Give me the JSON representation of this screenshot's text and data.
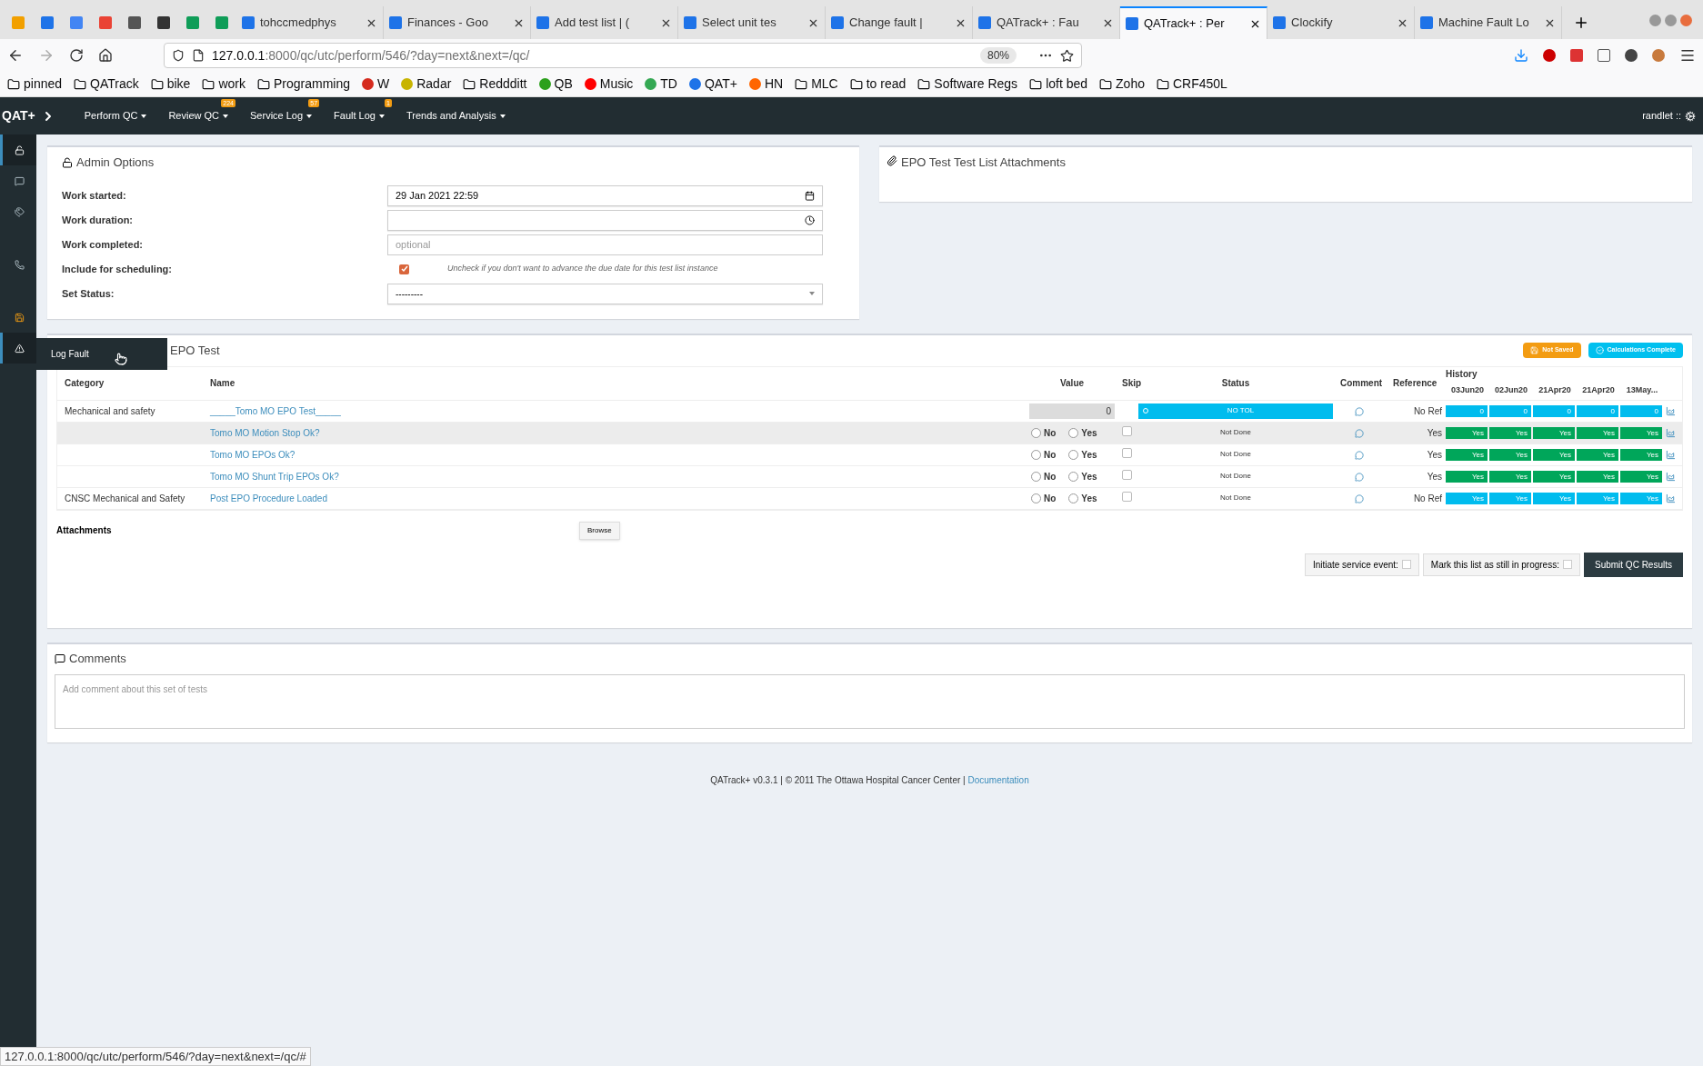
{
  "browser": {
    "tabs": [
      {
        "title": "tohccmedphys",
        "selected": false
      },
      {
        "title": "Finances - Goo",
        "selected": false
      },
      {
        "title": "Add test list | (",
        "selected": false
      },
      {
        "title": "Select unit tes",
        "selected": false
      },
      {
        "title": "Change fault |",
        "selected": false
      },
      {
        "title": "QATrack+ : Fau",
        "selected": false
      },
      {
        "title": "QATrack+ : Per",
        "selected": true
      },
      {
        "title": "Clockify",
        "selected": false
      },
      {
        "title": "Machine Fault Lo",
        "selected": false
      }
    ],
    "url_host": "127.0.0.1",
    "url_rest": ":8000/qc/utc/perform/546/?day=next&next=/qc/",
    "zoom": "80%",
    "bookmarks": [
      {
        "label": "pinned",
        "kind": "folder"
      },
      {
        "label": "QATrack",
        "kind": "folder"
      },
      {
        "label": "bike",
        "kind": "folder"
      },
      {
        "label": "work",
        "kind": "folder"
      },
      {
        "label": "Programming",
        "kind": "folder"
      },
      {
        "label": "W",
        "kind": "site",
        "color": "#d52b1e"
      },
      {
        "label": "Radar",
        "kind": "site",
        "color": "#c8b400"
      },
      {
        "label": "Reddditt",
        "kind": "folder"
      },
      {
        "label": "QB",
        "kind": "site",
        "color": "#2ca01c"
      },
      {
        "label": "Music",
        "kind": "site",
        "color": "#ff0000"
      },
      {
        "label": "TD",
        "kind": "site",
        "color": "#34a853"
      },
      {
        "label": "QAT+",
        "kind": "site",
        "color": "#1e73e8"
      },
      {
        "label": "HN",
        "kind": "site",
        "color": "#ff6600"
      },
      {
        "label": "MLC",
        "kind": "folder"
      },
      {
        "label": "to read",
        "kind": "folder"
      },
      {
        "label": "Software Regs",
        "kind": "folder"
      },
      {
        "label": "loft bed",
        "kind": "folder"
      },
      {
        "label": "Zoho",
        "kind": "folder"
      },
      {
        "label": "CRF450L",
        "kind": "folder"
      }
    ],
    "status_link": "127.0.0.1:8000/qc/utc/perform/546/?day=next&next=/qc/#"
  },
  "navbar": {
    "brand": "QAT+",
    "menus": [
      {
        "label": "Perform QC"
      },
      {
        "label": "Review QC",
        "badge": "224"
      },
      {
        "label": "Service Log",
        "badge": "57"
      },
      {
        "label": "Fault Log",
        "badge": "1"
      },
      {
        "label": "Trends and Analysis"
      }
    ],
    "user": "randlet ::"
  },
  "sidebar": {
    "items": [
      {
        "kind": "lock",
        "selected": true
      },
      {
        "kind": "comment",
        "selected": false
      },
      {
        "kind": "tags",
        "selected": false
      },
      {
        "kind": "phone",
        "selected": false
      },
      {
        "kind": "save",
        "selected": false
      },
      {
        "kind": "warning",
        "selected": true
      }
    ],
    "flyout": "Log Fault"
  },
  "admin": {
    "title": "Admin Options",
    "work_started_label": "Work started:",
    "work_started": "29 Jan 2021 22:59",
    "work_duration_label": "Work duration:",
    "work_completed_label": "Work completed:",
    "work_completed_placeholder": "optional",
    "scheduling_label": "Include for scheduling:",
    "scheduling_checked": true,
    "scheduling_hint": "Uncheck if you don't want to advance the due date for this test list instance",
    "status_label": "Set Status:",
    "status_value": "---------"
  },
  "attachments_panel": {
    "title": "EPO Test Test List Attachments"
  },
  "test_list": {
    "title": "EPO Test",
    "not_saved": "Not Saved",
    "calculations": "Calculations Complete",
    "columns": [
      "Category",
      "Name",
      "Value",
      "Skip",
      "Status",
      "Comment",
      "Reference",
      "History"
    ],
    "history_dates": [
      "03Jun20",
      "02Jun20",
      "21Apr20",
      "21Apr20",
      "13May..."
    ],
    "rows": [
      {
        "category": "Mechanical and safety",
        "name": "_____Tomo MO EPO Test_____",
        "kind": "numeric",
        "value": "0",
        "status": "NO TOL",
        "status_highlighted": true,
        "reference": "No Ref",
        "highlighted": false,
        "history": {
          "color": "#00bcee",
          "values": [
            "0",
            "0",
            "0",
            "0",
            "0"
          ]
        }
      },
      {
        "name": "Tomo MO Motion Stop Ok?",
        "kind": "boolean",
        "options": [
          {
            "label": "No",
            "selected": false
          },
          {
            "label": "Yes",
            "selected": false
          }
        ],
        "skipped": false,
        "status": "Not Done",
        "reference": "Yes",
        "highlighted": true,
        "history": {
          "color": "#00a65a",
          "values": [
            "Yes",
            "Yes",
            "Yes",
            "Yes",
            "Yes"
          ]
        }
      },
      {
        "name": "Tomo MO EPOs Ok?",
        "kind": "boolean",
        "options": [
          {
            "label": "No",
            "selected": false
          },
          {
            "label": "Yes",
            "selected": false
          }
        ],
        "skipped": false,
        "status": "Not Done",
        "reference": "Yes",
        "highlighted": false,
        "history": {
          "color": "#00a65a",
          "values": [
            "Yes",
            "Yes",
            "Yes",
            "Yes",
            "Yes"
          ]
        }
      },
      {
        "name": "Tomo MO Shunt Trip EPOs Ok?",
        "kind": "boolean",
        "options": [
          {
            "label": "No",
            "selected": false
          },
          {
            "label": "Yes",
            "selected": false
          }
        ],
        "skipped": false,
        "status": "Not Done",
        "reference": "Yes",
        "highlighted": false,
        "history": {
          "color": "#00a65a",
          "values": [
            "Yes",
            "Yes",
            "Yes",
            "Yes",
            "Yes"
          ]
        }
      },
      {
        "category": "CNSC Mechanical and Safety",
        "name": "Post EPO Procedure Loaded",
        "kind": "boolean",
        "options": [
          {
            "label": "No",
            "selected": false
          },
          {
            "label": "Yes",
            "selected": false
          }
        ],
        "skipped": false,
        "status": "Not Done",
        "reference": "No Ref",
        "highlighted": false,
        "history": {
          "color": "#00bcee",
          "values": [
            "Yes",
            "Yes",
            "Yes",
            "Yes",
            "Yes"
          ]
        }
      }
    ],
    "attachments_label": "Attachments",
    "browse": "Browse",
    "service_event_label": "Initiate service event:",
    "service_event_checked": false,
    "in_progress_label": "Mark this list as still in progress:",
    "in_progress_checked": false,
    "submit": "Submit QC Results"
  },
  "comments": {
    "title": "Comments",
    "placeholder": "Add comment about this set of tests"
  },
  "footer": {
    "text": "QATrack+ v0.3.1 | © 2011 The Ottawa Hospital Cancer Center |",
    "link": "Documentation"
  }
}
